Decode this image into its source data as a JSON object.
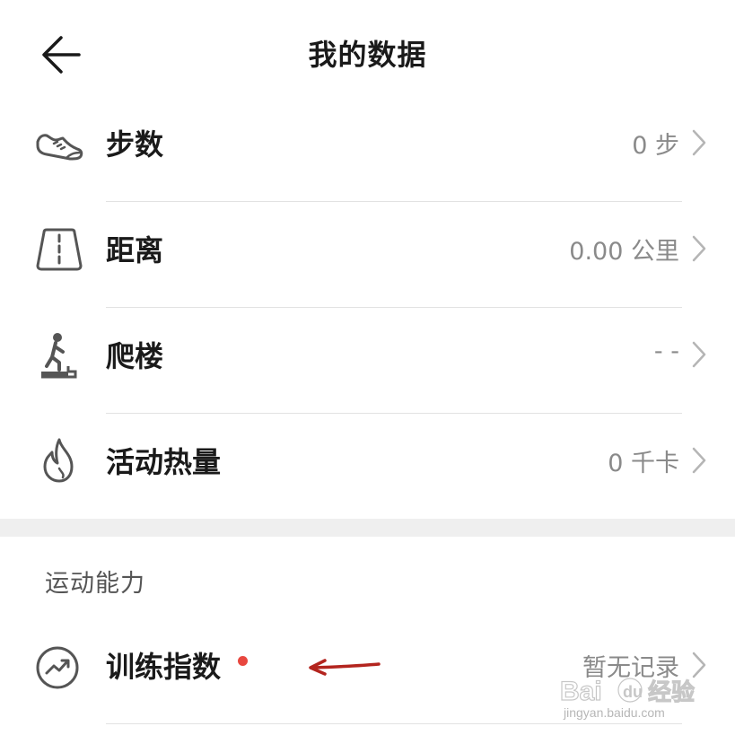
{
  "header": {
    "title": "我的数据",
    "back_icon": "arrow-left-icon"
  },
  "rows": [
    {
      "label": "步数",
      "value": "0 步",
      "icon": "sneaker-icon"
    },
    {
      "label": "距离",
      "value": "0.00 公里",
      "icon": "road-icon"
    },
    {
      "label": "爬楼",
      "value": "- -",
      "icon": "stair-climber-icon"
    },
    {
      "label": "活动热量",
      "value": "0 千卡",
      "icon": "flame-icon"
    }
  ],
  "section": {
    "title": "运动能力",
    "rows": [
      {
        "label": "训练指数",
        "value": "暂无记录",
        "icon": "trend-circle-icon",
        "has_badge": true
      }
    ]
  },
  "colors": {
    "badge": "#e8473f",
    "annotation_arrow": "#b3241e",
    "divider": "#e2e2e2",
    "section_gap": "#efefef",
    "value_text": "#8a8a8a"
  },
  "watermark": {
    "text": "Bai du 经验",
    "sub": "jingyan.baidu.com"
  }
}
